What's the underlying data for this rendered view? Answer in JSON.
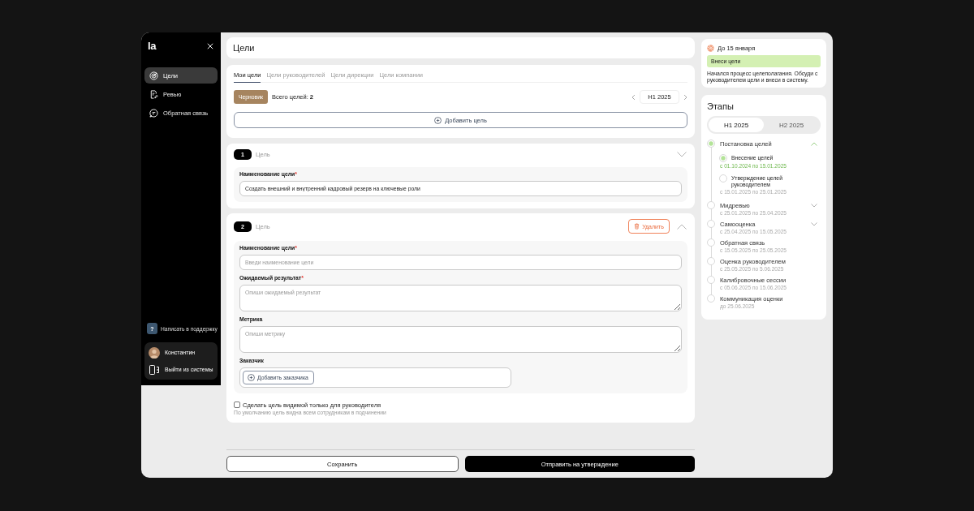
{
  "sidebar": {
    "logo": "la",
    "items": [
      {
        "label": "Цели",
        "selected": true
      },
      {
        "label": "Ревью",
        "selected": false
      },
      {
        "label": "Обратная связь",
        "selected": false
      }
    ],
    "support": {
      "icon": "?",
      "label": "Написать в поддержку"
    },
    "user": {
      "name": "Константин",
      "logout": "Выйти из системы"
    }
  },
  "page_title": "Цели",
  "tabs": [
    {
      "label": "Мои цели",
      "selected": true
    },
    {
      "label": "Цели руководителей",
      "selected": false
    },
    {
      "label": "Цели дирекции",
      "selected": false
    },
    {
      "label": "Цели компании",
      "selected": false
    }
  ],
  "status_badge": "Черновик",
  "goal_count": "Всего целей: **2**",
  "period": "Н1 2025",
  "add_goal_button": "Добавить цель",
  "goals": [
    {
      "number": "1",
      "label": "Цель",
      "expanded": false,
      "fields": [
        {
          "kind": "input",
          "label": "Наименование цели",
          "required_mark": "*",
          "value": "Создать внешний и внутренний кадровый резерв на ключевые роли"
        }
      ]
    },
    {
      "number": "2",
      "label": "Цель",
      "expanded": true,
      "delete_button": "Удалить",
      "fields": [
        {
          "kind": "input",
          "label": "Наименование цели",
          "required_mark": "*",
          "placeholder": "Введи наименование цели"
        },
        {
          "kind": "textarea",
          "label": "Ожидаемый результат",
          "required_mark": "*",
          "placeholder": "Опиши ожидаемый результат"
        },
        {
          "kind": "textarea",
          "label": "Метрика",
          "placeholder": "Опиши метрику"
        },
        {
          "kind": "picker",
          "label": "Заказчик",
          "button": "Добавить заказчика"
        }
      ],
      "visibility_option": {
        "label": "Сделать цель видимой только для руководителя",
        "checked": false,
        "hint": "По умолчанию цель видна всем сотрудникам в подчинении"
      }
    }
  ],
  "actions": {
    "save": "Сохранить",
    "submit": "Отправить на утверждение"
  },
  "deadline": {
    "title": "До 15 января",
    "task": "Внеси цели",
    "text": "Начался процесс целеполагания. Обсуди с руководителем цели и внеси в систему."
  },
  "stages": {
    "title": "Этапы",
    "periods": [
      {
        "label": "Н1 2025",
        "selected": true
      },
      {
        "label": "Н2 2025",
        "selected": false
      }
    ],
    "items": [
      {
        "name": "Постановка целей",
        "active": true,
        "expanded": true,
        "children": [
          {
            "name": "Внесение целей",
            "active": true,
            "date": "с 01.10.2024 по 15.01.2025"
          },
          {
            "name": "Утверждение целей руководителем",
            "active": false,
            "date": "с 15.01.2025 по 25.01.2025"
          }
        ]
      },
      {
        "name": "Мидревью",
        "active": false,
        "expanded": false,
        "date": "с 25.01.2025 по 25.04.2025"
      },
      {
        "name": "Самооценка",
        "active": false,
        "expanded": false,
        "date": "с 25.04.2025 по 15.05.2025"
      },
      {
        "name": "Обратная связь",
        "active": false,
        "date": "с 15.05.2025 по 25.05.2025"
      },
      {
        "name": "Оценка руководителем",
        "active": false,
        "date": "с 25.05.2025 по 5.06.2025"
      },
      {
        "name": "Калибровочные сессии",
        "active": false,
        "date": "с 05.06.2025 по 15.06.2025"
      },
      {
        "name": "Коммуникация оценки",
        "active": false,
        "date": "до 25.06.2025"
      }
    ]
  }
}
